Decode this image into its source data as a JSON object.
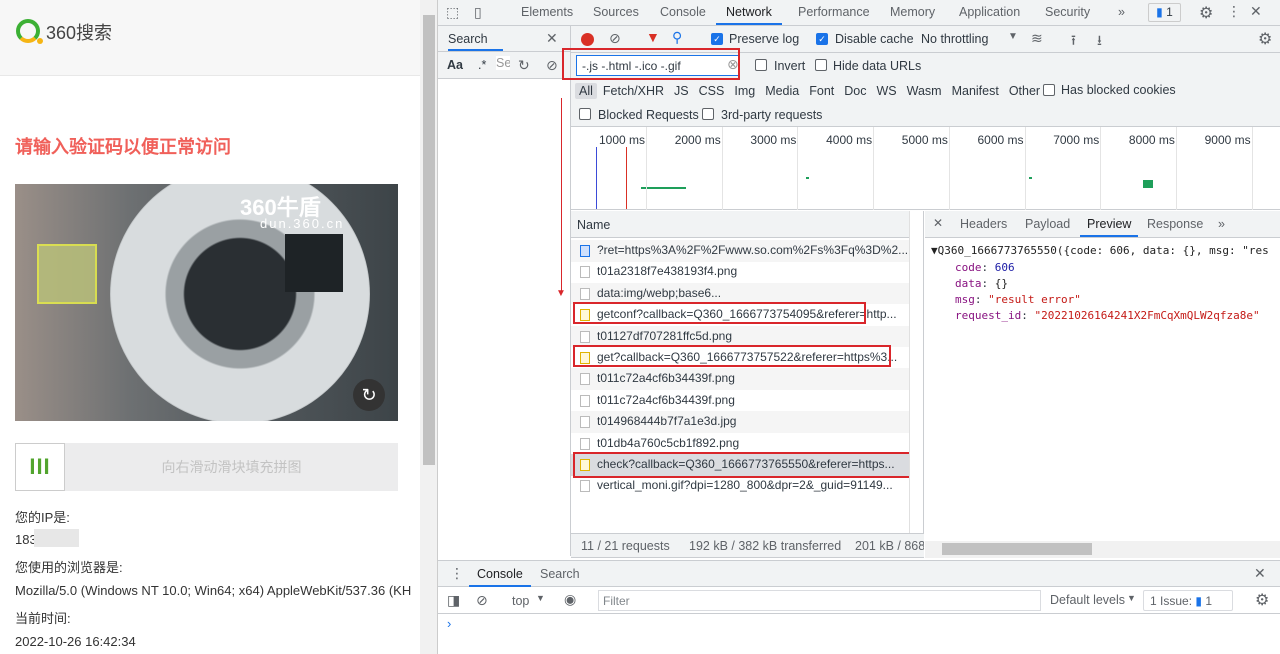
{
  "page": {
    "logo_text": "360搜索",
    "warning": "请输入验证码以便正常访问",
    "captcha_brand": "360牛盾",
    "captcha_domain": "dun.360.cn",
    "slider_hint": "向右滑动滑块填充拼图",
    "slider_handle": "III",
    "ip_label": "您的IP是:",
    "ip_value": "183",
    "browser_label": "您使用的浏览器是:",
    "browser_value": "Mozilla/5.0 (Windows NT 10.0; Win64; x64) AppleWebKit/537.36 (KH",
    "time_label": "当前时间:",
    "time_value": "2022-10-26 16:42:34"
  },
  "devtools": {
    "tabs": [
      "Elements",
      "Sources",
      "Console",
      "Network",
      "Performance",
      "Memory",
      "Application",
      "Security"
    ],
    "active_tab": "Network",
    "more": "»",
    "issues_badge": "1",
    "search_panel": {
      "title": "Search",
      "aa": "Aa",
      "regex": ".*",
      "input_placeholder": "Se"
    },
    "toolbar": {
      "preserve_log": "Preserve log",
      "preserve_log_checked": true,
      "disable_cache": "Disable cache",
      "disable_cache_checked": true,
      "throttling": "No throttling"
    },
    "filter": {
      "value": "-.js -.html -.ico -.gif",
      "invert": "Invert",
      "hide_data_urls": "Hide data URLs"
    },
    "types": [
      "All",
      "Fetch/XHR",
      "JS",
      "CSS",
      "Img",
      "Media",
      "Font",
      "Doc",
      "WS",
      "Wasm",
      "Manifest",
      "Other"
    ],
    "active_type": "All",
    "has_blocked_cookies": "Has blocked cookies",
    "blocked_requests": "Blocked Requests",
    "third_party": "3rd-party requests",
    "timeline_ticks": [
      "1000 ms",
      "2000 ms",
      "3000 ms",
      "4000 ms",
      "5000 ms",
      "6000 ms",
      "7000 ms",
      "8000 ms",
      "9000 ms",
      "1"
    ],
    "list_header": "Name",
    "requests": [
      {
        "name": "?ret=https%3A%2F%2Fwww.so.com%2Fs%3Fq%3D%2...",
        "icon": "document-icon",
        "highlighted": false
      },
      {
        "name": "t01a2318f7e438193f4.png",
        "icon": "image-icon",
        "highlighted": false
      },
      {
        "name": "data:img/webp;base6...",
        "icon": "image-icon",
        "highlighted": false
      },
      {
        "name": "getconf?callback=Q360_1666773754095&referer=http...",
        "icon": "script-icon",
        "highlighted": true
      },
      {
        "name": "t01127df707281ffc5d.png",
        "icon": "image-icon",
        "highlighted": false
      },
      {
        "name": "get?callback=Q360_1666773757522&referer=https%3...",
        "icon": "script-icon",
        "highlighted": true
      },
      {
        "name": "t011c72a4cf6b34439f.png",
        "icon": "image-icon",
        "highlighted": false
      },
      {
        "name": "t011c72a4cf6b34439f.png",
        "icon": "image-icon",
        "highlighted": false
      },
      {
        "name": "t014968444b7f7a1e3d.jpg",
        "icon": "image-icon",
        "highlighted": false
      },
      {
        "name": "t01db4a760c5cb1f892.png",
        "icon": "image-icon",
        "highlighted": false
      },
      {
        "name": "check?callback=Q360_1666773765550&referer=https...",
        "icon": "script-icon",
        "highlighted": true
      },
      {
        "name": "vertical_moni.gif?dpi=1280_800&dpr=2&_guid=91149...",
        "icon": "image-icon",
        "highlighted": false
      }
    ],
    "status": {
      "requests": "11 / 21 requests",
      "transferred": "192 kB / 382 kB transferred",
      "resources": "201 kB / 868"
    },
    "detail_tabs": [
      "Headers",
      "Payload",
      "Preview",
      "Response"
    ],
    "active_detail_tab": "Preview",
    "preview": {
      "summary": "Q360_1666773765550({code: 606, data: {}, msg: \"res",
      "fields": [
        {
          "key": "code",
          "value": "606"
        },
        {
          "key": "data",
          "value": "{}"
        },
        {
          "key": "msg",
          "value": "\"result error\""
        },
        {
          "key": "request_id",
          "value": "\"20221026164241X2FmCqXmQLW2qfza8e\""
        }
      ]
    },
    "drawer": {
      "tabs": [
        "Console",
        "Search"
      ],
      "active": "Console",
      "context": "top",
      "filter_placeholder": "Filter",
      "levels": "Default levels",
      "issues": "1 Issue:",
      "issues_count": "1",
      "prompt": "›"
    },
    "colors": {
      "accent": "#1a73e8",
      "highlight_box": "#d9262b",
      "record": "#d93025"
    }
  }
}
